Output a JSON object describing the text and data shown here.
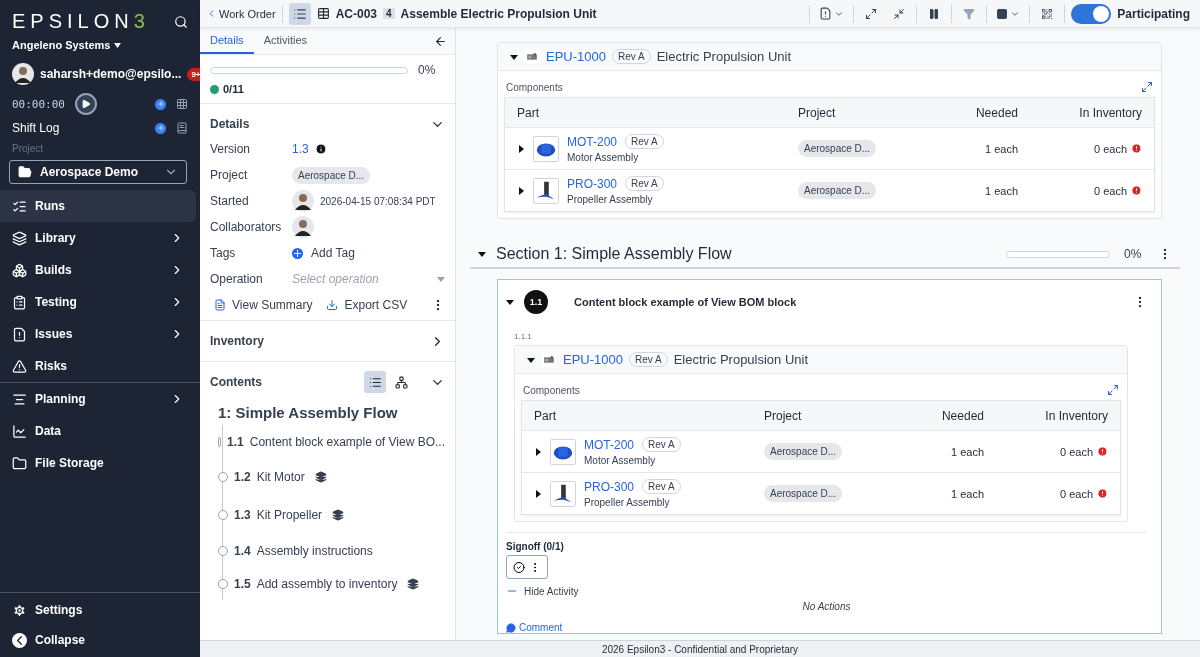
{
  "sidebar": {
    "logo": "EPSILON",
    "logo_accent": "3",
    "organization": "Angeleno Systems",
    "user": "saharsh+demo@epsilo...",
    "notifications": "9+",
    "timer": "00:00:00",
    "shift_log": "Shift Log",
    "project_label": "Project",
    "project": "Aerospace Demo",
    "nav": [
      {
        "label": "Runs",
        "selected": true,
        "expandable": false
      },
      {
        "label": "Library",
        "selected": false,
        "expandable": true
      },
      {
        "label": "Builds",
        "selected": false,
        "expandable": true
      },
      {
        "label": "Testing",
        "selected": false,
        "expandable": true
      },
      {
        "label": "Issues",
        "selected": false,
        "expandable": true
      },
      {
        "label": "Risks",
        "selected": false,
        "expandable": false
      }
    ],
    "nav_secondary": [
      {
        "label": "Planning",
        "selected": false,
        "expandable": true
      },
      {
        "label": "Data",
        "selected": false,
        "expandable": false
      },
      {
        "label": "File Storage",
        "selected": false,
        "expandable": false
      }
    ],
    "bottom": [
      {
        "label": "Settings"
      },
      {
        "label": "Collapse"
      }
    ]
  },
  "topbar": {
    "back": "Work Order",
    "run_id": "AC-003",
    "count": "4",
    "title": "Assemble Electric Propulsion Unit",
    "participating": {
      "label": "Participating",
      "on": true
    }
  },
  "panel": {
    "tabs": [
      {
        "label": "Details",
        "selected": true
      },
      {
        "label": "Activities",
        "selected": false
      }
    ],
    "progress": {
      "level": 0,
      "reading": "0%",
      "count": "0/11"
    },
    "details": {
      "title": "Details",
      "expanded": true,
      "fields": [
        {
          "label": "Version",
          "kind": "link",
          "value": "1.3"
        },
        {
          "label": "Project",
          "kind": "chip",
          "value": "Aerospace D..."
        },
        {
          "label": "Started",
          "kind": "user",
          "value": "2026-04-15 07:08:34 PDT"
        },
        {
          "label": "Collaborators",
          "kind": "avatar"
        },
        {
          "label": "Tags",
          "kind": "add",
          "value": "Add Tag"
        },
        {
          "label": "Operation",
          "kind": "select",
          "placeholder": "Select operation"
        }
      ]
    },
    "actions": [
      "View Summary",
      "Export CSV"
    ],
    "inventory": {
      "title": "Inventory",
      "expanded": false
    },
    "contents": {
      "title": "Contents",
      "expanded": true,
      "section": "1: Simple Assembly Flow",
      "steps": [
        {
          "number": "1.1",
          "title": "Content block example of View BO...",
          "inventory": false
        },
        {
          "number": "1.2",
          "title": "Kit Motor",
          "inventory": true
        },
        {
          "number": "1.3",
          "title": "Kit Propeller",
          "inventory": true
        },
        {
          "number": "1.4",
          "title": "Assembly instructions",
          "inventory": false
        },
        {
          "number": "1.5",
          "title": "Add assembly to inventory",
          "inventory": true
        }
      ]
    }
  },
  "main": {
    "bom": {
      "part": "EPU-1000",
      "rev": "Rev A",
      "name": "Electric Propulsion Unit",
      "components_label": "Components",
      "columns": [
        "Part",
        "Project",
        "Needed",
        "In Inventory"
      ],
      "rows": [
        {
          "part": "MOT-200",
          "rev": "Rev A",
          "name": "Motor Assembly",
          "project": "Aerospace D...",
          "needed": "1 each",
          "inventory": "0 each"
        },
        {
          "part": "PRO-300",
          "rev": "Rev A",
          "name": "Propeller Assembly",
          "project": "Aerospace D...",
          "needed": "1 each",
          "inventory": "0 each"
        }
      ]
    },
    "section": {
      "title": "Section 1: Simple Assembly Flow",
      "level": 0,
      "reading": "0%"
    },
    "step": {
      "number": "1.1",
      "title": "Content block example of View BOM block",
      "block_number": "1.1.1",
      "bom": {
        "part": "EPU-1000",
        "rev": "Rev A",
        "name": "Electric Propulsion Unit",
        "components_label": "Components",
        "columns": [
          "Part",
          "Project",
          "Needed",
          "In Inventory"
        ],
        "rows": [
          {
            "part": "MOT-200",
            "rev": "Rev A",
            "name": "Motor Assembly",
            "project": "Aerospace D...",
            "needed": "1 each",
            "inventory": "0 each"
          },
          {
            "part": "PRO-300",
            "rev": "Rev A",
            "name": "Propeller Assembly",
            "project": "Aerospace D...",
            "needed": "1 each",
            "inventory": "0 each"
          }
        ]
      },
      "signoff": "Signoff (0/1)",
      "hide_activity": "Hide Activity",
      "no_actions": "No Actions",
      "comment": "Comment"
    }
  },
  "footer": "2026 Epsilon3 - Confidential and Proprietary"
}
